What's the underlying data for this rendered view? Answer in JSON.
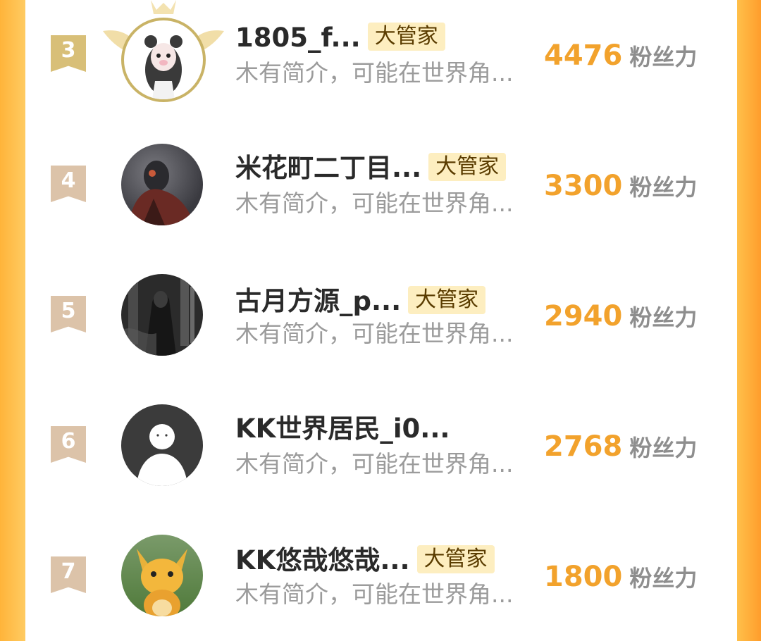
{
  "list": {
    "fans_unit": "粉丝力",
    "items": [
      {
        "rank": "3",
        "name": "1805_f...",
        "badge": "大管家",
        "bio": "木有简介，可能在世界角...",
        "fans": "4476"
      },
      {
        "rank": "4",
        "name": "米花町二丁目...",
        "badge": "大管家",
        "bio": "木有简介，可能在世界角...",
        "fans": "3300"
      },
      {
        "rank": "5",
        "name": "古月方源_p...",
        "badge": "大管家",
        "bio": "木有简介，可能在世界角...",
        "fans": "2940"
      },
      {
        "rank": "6",
        "name": "KK世界居民_i0...",
        "badge": "",
        "bio": "木有简介，可能在世界角...",
        "fans": "2768"
      },
      {
        "rank": "7",
        "name": "KK悠哉悠哉...",
        "badge": "大管家",
        "bio": "木有简介，可能在世界角...",
        "fans": "1800"
      }
    ]
  },
  "colors": {
    "accent": "#f2a22c",
    "badge_bg": "#fdeec0",
    "side": "#ffb43a"
  }
}
